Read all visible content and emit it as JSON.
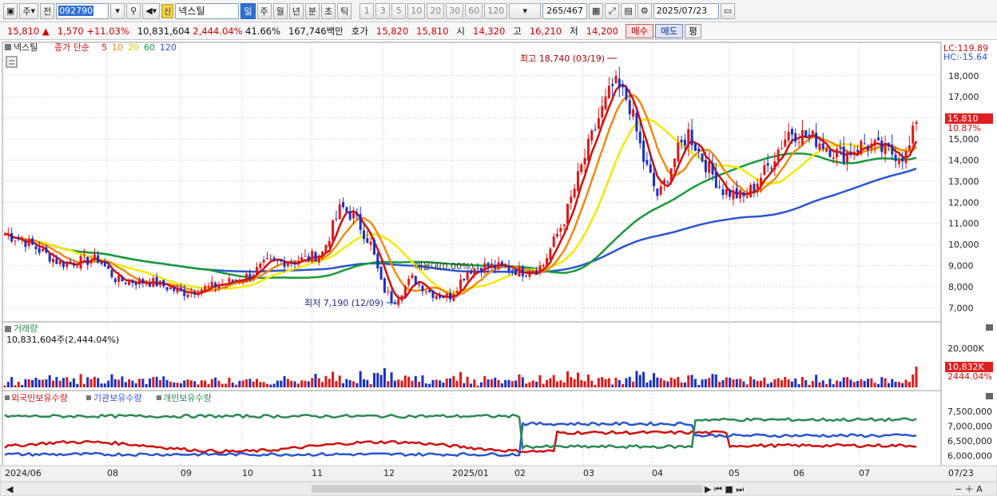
{
  "toolbar": {
    "type_label": "주",
    "prev_label": "전",
    "stock_code": "092790",
    "stock_badge": "신",
    "stock_name": "넥스틸",
    "periods": [
      "일",
      "주",
      "월",
      "년",
      "분",
      "초",
      "틱"
    ],
    "active_period": "일",
    "intervals": [
      "1",
      "3",
      "5",
      "10",
      "20",
      "30",
      "60",
      "120"
    ],
    "count_display": "265",
    "count_total": "/467",
    "date": "2025/07/23"
  },
  "quote": {
    "price": "15,810",
    "up_mark": "▲",
    "change": "1,570",
    "change_pct": "+11.03%",
    "volume": "10,831,604",
    "volume_pct": "2,444.04%",
    "ratio": "41.66%",
    "amount": "167,746백만",
    "hoga_label": "호가",
    "hoga_ask": "15,820",
    "hoga_bid": "15,810",
    "open_label": "시",
    "open": "14,320",
    "high_label": "고",
    "high": "16,210",
    "low_label": "저",
    "low": "14,200",
    "buy_label": "매수",
    "sell_label": "매도",
    "avg_label": "평"
  },
  "price_panel": {
    "legend_name": "넥스틸",
    "legend_ma_title": "종가 단순",
    "ma_periods": [
      {
        "label": "5",
        "color": "#d01010"
      },
      {
        "label": "10",
        "color": "#f08a10"
      },
      {
        "label": "20",
        "color": "#e8d800"
      },
      {
        "label": "60",
        "color": "#1a9a3a"
      },
      {
        "label": "120",
        "color": "#2a55d0"
      }
    ],
    "y_ticks": [
      "18,000",
      "17,000",
      "16,000",
      "15,000",
      "14,000",
      "13,000",
      "12,000",
      "11,000",
      "10,000",
      "9,000",
      "8,000",
      "7,000"
    ],
    "lc_label": "LC:119.89",
    "hc_label": "HC:-15.64",
    "current_price_label": "15,810",
    "current_pct_label": "10.87%",
    "high_annotation": "최고 18,740 (03/19)",
    "low_annotation": "최저 7,190 (12/09)",
    "overlay_text": "매물대(0.00%)"
  },
  "volume_panel": {
    "title": "거래량",
    "value_text": "10,831,604주(2,444.04%)",
    "y_tick": "20,000K",
    "current_label": "10,832K",
    "current_pct": "2444.04%"
  },
  "holding_panel": {
    "legend": [
      {
        "label": "외국인보유수량",
        "color": "#d01010"
      },
      {
        "label": "기관보유수량",
        "color": "#2a55d0"
      },
      {
        "label": "개인보유수량",
        "color": "#2a8a50"
      }
    ],
    "y_ticks": [
      "7,500,000",
      "7,000,000",
      "6,500,000",
      "6,000,000"
    ]
  },
  "x_axis": {
    "labels": [
      "2024/06",
      "08",
      "09",
      "10",
      "11",
      "12",
      "2025/01",
      "02",
      "03",
      "04",
      "05",
      "06",
      "07",
      "07/23"
    ]
  },
  "chart_data": {
    "type": "candlestick",
    "title": "넥스틸",
    "high": {
      "value": 18740,
      "date": "03/19"
    },
    "low": {
      "value": 7190,
      "date": "12/09"
    },
    "last_close": 15810,
    "moving_averages": [
      5,
      10,
      20,
      60,
      120
    ],
    "ylim": [
      6600,
      18900
    ]
  }
}
